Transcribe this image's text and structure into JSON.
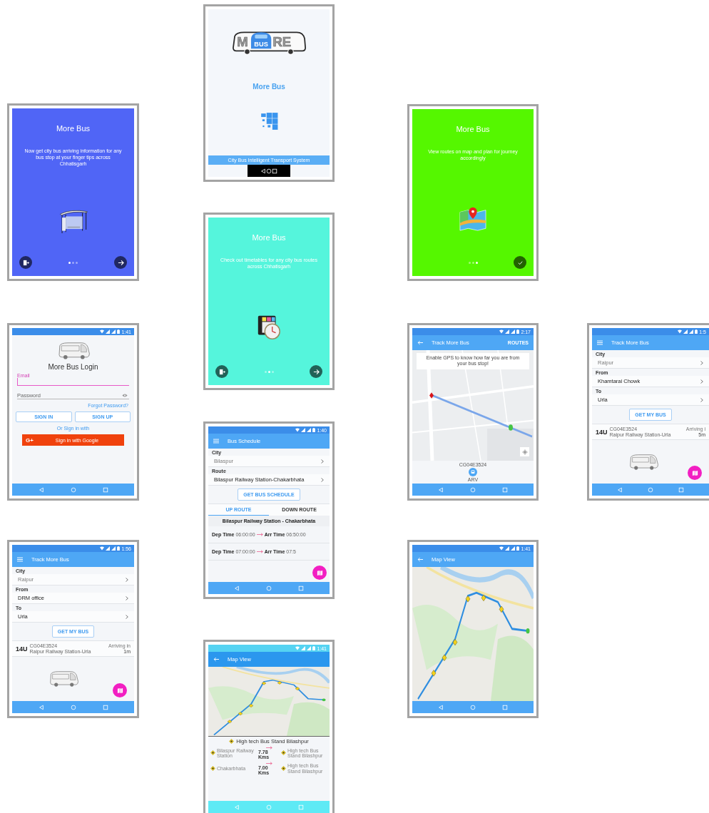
{
  "screens": [
    {
      "kind": "splash",
      "logo": {
        "left": "M",
        "right": "RE",
        "badge": "BUS"
      },
      "title": "More Bus",
      "footer": "City Bus Intelligent Transport System"
    },
    {
      "kind": "onboarding",
      "color": "#5065f6",
      "title": "More Bus",
      "description": "Now get city bus arriving information for any bus stop at your finger tips across Chhatisgarh",
      "illustration": {
        "kind": "bus-shelter"
      },
      "skip": true,
      "dots": [
        {
          "selected": true
        },
        {
          "selected": false
        },
        {
          "selected": false
        }
      ],
      "finish_button": {
        "kind": "next"
      }
    },
    {
      "kind": "onboarding",
      "color": "#55f700",
      "title": "More Bus",
      "description": "View routes on map and plan for journey accordingly",
      "illustration": {
        "kind": "map-pin"
      },
      "skip": false,
      "dots": [
        {
          "selected": false
        },
        {
          "selected": false
        },
        {
          "selected": true
        }
      ],
      "finish_button": {
        "kind": "done"
      }
    },
    {
      "kind": "onboarding",
      "color": "#55f5dc",
      "title": "More Bus",
      "description": "Check out timetables for any city bus routes across Chhatisgarh",
      "illustration": {
        "kind": "calendar-clock"
      },
      "skip": true,
      "dots": [
        {
          "selected": false
        },
        {
          "selected": true
        },
        {
          "selected": false
        }
      ],
      "finish_button": {
        "kind": "next"
      }
    },
    {
      "kind": "login",
      "status_time": "1:41",
      "title": "More Bus Login",
      "fields": [
        {
          "label": "Email",
          "focused": true
        },
        {
          "placeholder": "Password",
          "focused": false
        }
      ],
      "forgot_link": "Forgot Password?",
      "buttons": [
        "SIGN IN",
        "SIGN UP"
      ],
      "alt_text": "Or Sign in with",
      "google_button": {
        "icon": "G+",
        "label": "Sign in with Google"
      }
    },
    {
      "kind": "track-map",
      "status_time": "2:17",
      "app_bar": {
        "nav_button": {
          "kind": "back"
        },
        "title": "Track More Bus",
        "action": "ROUTES"
      },
      "banner": "Enable GPS to know how far you are from your bus stop!",
      "bus": {
        "vehicle": "CG04E3524",
        "status": "ARV"
      }
    },
    {
      "kind": "track-form",
      "status_time": "1:5",
      "app_bar": {
        "nav_button": {
          "kind": "menu"
        },
        "title": "Track More Bus"
      },
      "fields": [
        {
          "label": "City",
          "value": "Raipur",
          "disabled": true
        },
        {
          "label": "From",
          "value": "Khamtarai Chowk",
          "disabled": false
        },
        {
          "label": "To",
          "value": "Urla",
          "disabled": false
        }
      ],
      "button": "GET MY BUS",
      "result": {
        "route": "14U",
        "vehicle": "CG04E3524",
        "path": "Raipur Railway Station-Urla",
        "eta_label": "Arriving i",
        "eta": "5m"
      }
    },
    {
      "kind": "schedule",
      "status_time": "1:40",
      "app_bar": {
        "nav_button": {
          "kind": "menu"
        },
        "title": "Bus Schedule"
      },
      "fields": [
        {
          "label": "City",
          "value": "Bilaspur",
          "disabled": true
        },
        {
          "label": "Route",
          "value": "Bilaspur Railway Station-Chakarbhata",
          "disabled": false
        }
      ],
      "button": "GET BUS SCHEDULE",
      "tabs": [
        {
          "label": "UP ROUTE",
          "selected": true
        },
        {
          "label": "DOWN ROUTE",
          "selected": false
        }
      ],
      "route_title": "Bilaspur Railway Station - Chakarbhata",
      "trips": [
        {
          "dep_label": "Dep Time",
          "dep": "06:00:00",
          "arr_label": "Arr Time",
          "arr": "06:50:00"
        },
        {
          "dep_label": "Dep Time",
          "dep": "07:00:00",
          "arr_label": "Arr Time",
          "arr": "07:5"
        }
      ]
    },
    {
      "kind": "track-form",
      "status_time": "1:56",
      "app_bar": {
        "nav_button": {
          "kind": "menu"
        },
        "title": "Track More Bus"
      },
      "fields": [
        {
          "label": "City",
          "value": "Raipur",
          "disabled": true
        },
        {
          "label": "From",
          "value": "DRM office",
          "disabled": false
        },
        {
          "label": "To",
          "value": "Urla",
          "disabled": false
        }
      ],
      "button": "GET MY BUS",
      "result": {
        "route": "14U",
        "vehicle": "CG04E3524",
        "path": "Raipur Railway Station-Urla",
        "eta_label": "Arriving in",
        "eta": "1m"
      }
    },
    {
      "kind": "map-view",
      "status_time": "1:41",
      "app_bar": {
        "nav_button": {
          "kind": "back"
        },
        "title": "Map View"
      }
    },
    {
      "kind": "map-view",
      "status_time": "1:41",
      "app_bar": {
        "nav_button": {
          "kind": "back"
        },
        "title": "Map View"
      },
      "stop_list": {
        "title": "High tech Bus Stand Bilashpur",
        "legs": [
          {
            "from": "Bilaspur Railway Station",
            "to": "High tech Bus Stand Bilashpur",
            "distance": "7.78 Kms"
          },
          {
            "from": "Chakarbhata",
            "to": "High tech Bus Stand Bilashpur",
            "distance": "7.00 Kms"
          }
        ]
      }
    }
  ]
}
